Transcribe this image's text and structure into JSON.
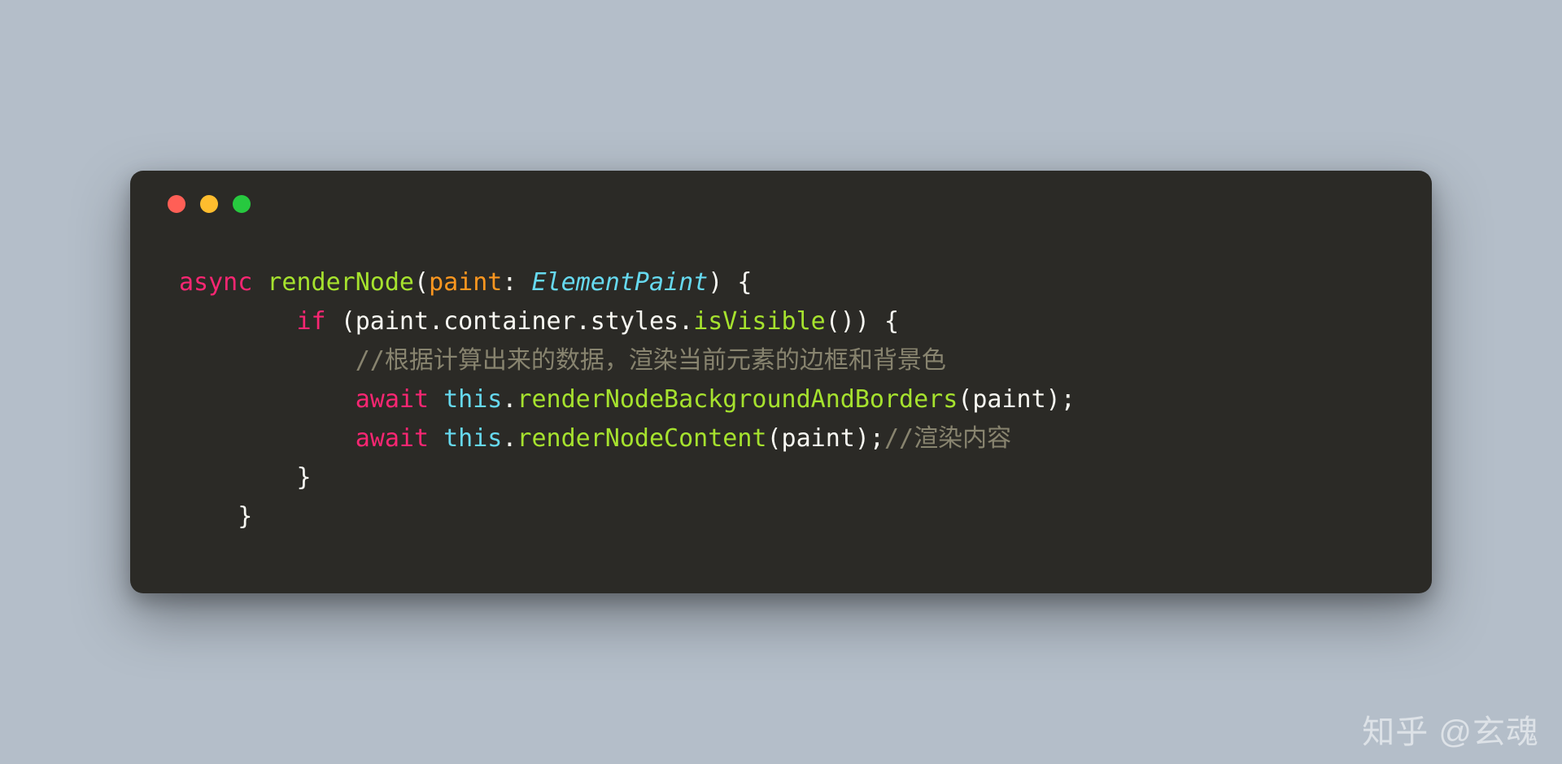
{
  "colors": {
    "bg": "#b4bec9",
    "window": "#2b2a26",
    "dot_red": "#ff5f56",
    "dot_yellow": "#ffbd2e",
    "dot_green": "#27c93f",
    "keyword": "#f92672",
    "function": "#a6e22e",
    "param": "#fd971f",
    "type": "#66d9ef",
    "plain": "#f8f8f2",
    "comment": "#88846f"
  },
  "code": {
    "line1": {
      "async": "async",
      "fn": "renderNode",
      "lparen": "(",
      "param": "paint",
      "colon": ": ",
      "type": "ElementPaint",
      "rparen_brace": ") {"
    },
    "line2": {
      "indent": "        ",
      "if": "if",
      "space": " ",
      "lparen": "(",
      "obj1": "paint",
      "dot1": ".",
      "prop1": "container",
      "dot2": ".",
      "prop2": "styles",
      "dot3": ".",
      "method": "isVisible",
      "call": "()",
      "rparen_brace": ") {"
    },
    "line3": {
      "indent": "            ",
      "comment": "//根据计算出来的数据，渲染当前元素的边框和背景色"
    },
    "line4": {
      "indent": "            ",
      "await": "await",
      "space": " ",
      "this": "this",
      "dot": ".",
      "method": "renderNodeBackgroundAndBorders",
      "lparen": "(",
      "arg": "paint",
      "rparen_semi": ");"
    },
    "line5": {
      "indent": "            ",
      "await": "await",
      "space": " ",
      "this": "this",
      "dot": ".",
      "method": "renderNodeContent",
      "lparen": "(",
      "arg": "paint",
      "rparen_semi": ");",
      "comment": "//渲染内容"
    },
    "line6": {
      "indent": "        ",
      "brace": "}"
    },
    "line7": {
      "indent": "    ",
      "brace": "}"
    }
  },
  "watermark": "知乎 @玄魂"
}
